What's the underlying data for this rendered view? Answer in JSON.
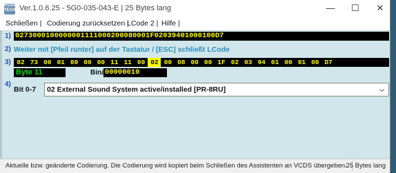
{
  "window": {
    "title": "Ver.1.0.6.25 - 5G0-035-043-E | 25 Bytes lang",
    "logo_text": "ROSS TECH",
    "minimize_icon": "—",
    "maximize_icon": "☐",
    "close_icon": "✕"
  },
  "menu": {
    "items": [
      "Schließen |",
      "Codierung zurücksetzen |",
      "LCode 2 |",
      "Hilfe |"
    ]
  },
  "row_numbers": [
    "1)",
    "2)",
    "3)",
    "4)"
  ],
  "coding": {
    "value": "0273000100000001111000200080001F02039401000100D7"
  },
  "hint": "Weiter mit [Pfeil runter] auf der Tastatur / [ESC] schließt LCode",
  "bytes": [
    "02",
    "73",
    "00",
    "01",
    "00",
    "00",
    "00",
    "11",
    "11",
    "00",
    "02",
    "00",
    "08",
    "00",
    "00",
    "1F",
    "02",
    "03",
    "94",
    "01",
    "00",
    "01",
    "00",
    "D7",
    "",
    "",
    "",
    ""
  ],
  "selected_byte_index": 10,
  "byte_label": "Byte 11",
  "binary": {
    "label": "Binär:",
    "value": "00000010"
  },
  "bit": {
    "label": "Bit 0-7",
    "selected": "02 External Sound System active/installed [PR-8RU]"
  },
  "status": {
    "left": "Aktuelle bzw. geänderte Codierung. Die Codierung wird kopiert beim Schließen des Assistenten an VCDS übergeben.",
    "right": "25 Bytes lang"
  },
  "colors": {
    "accent_blue": "#2a4db3",
    "hint_blue": "#2a8fbf",
    "content_bg": "#d0e6ea",
    "byte_text": "#ffff00",
    "byte_label_green": "#00dd00"
  }
}
